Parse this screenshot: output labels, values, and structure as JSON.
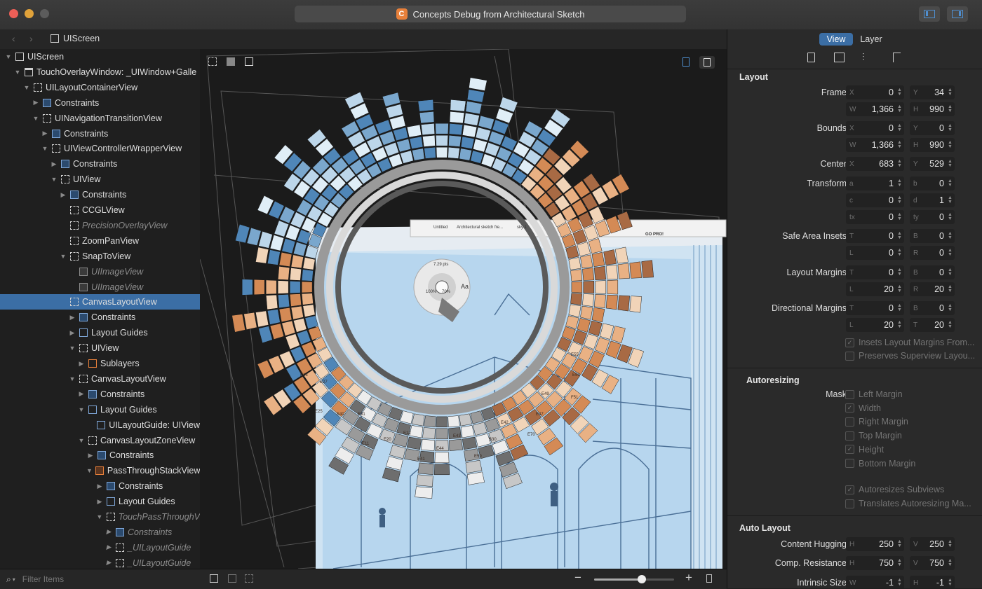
{
  "window": {
    "title": "Concepts Debug from Architectural Sketch",
    "app_icon_glyph": "C",
    "accent_color": "#3b6ea5"
  },
  "navigator": {
    "breadcrumb": "UIScreen",
    "filter_placeholder": "Filter Items"
  },
  "tree": [
    {
      "label": "UIScreen",
      "depth": 0,
      "icon": "solid",
      "open": true
    },
    {
      "label": "TouchOverlayWindow: _UIWindow+Galle",
      "depth": 1,
      "icon": "window",
      "open": true
    },
    {
      "label": "UILayoutContainerView",
      "depth": 2,
      "icon": "dash",
      "open": true
    },
    {
      "label": "Constraints",
      "depth": 3,
      "icon": "cons",
      "open": false
    },
    {
      "label": "UINavigationTransitionView",
      "depth": 3,
      "icon": "dash",
      "open": true
    },
    {
      "label": "Constraints",
      "depth": 4,
      "icon": "cons",
      "open": false
    },
    {
      "label": "UIViewControllerWrapperView",
      "depth": 4,
      "icon": "dash",
      "open": true
    },
    {
      "label": "Constraints",
      "depth": 5,
      "icon": "cons",
      "open": false
    },
    {
      "label": "UIView",
      "depth": 5,
      "icon": "dash",
      "open": true
    },
    {
      "label": "Constraints",
      "depth": 6,
      "icon": "cons",
      "open": false
    },
    {
      "label": "CCGLView",
      "depth": 6,
      "icon": "dash",
      "open": null
    },
    {
      "label": "PrecisionOverlayView",
      "depth": 6,
      "icon": "dash",
      "open": null,
      "dim": true
    },
    {
      "label": "ZoomPanView",
      "depth": 6,
      "icon": "dash",
      "open": null
    },
    {
      "label": "SnapToView",
      "depth": 6,
      "icon": "dash",
      "open": true
    },
    {
      "label": "UIImageView",
      "depth": 7,
      "icon": "img",
      "open": null,
      "dim": true
    },
    {
      "label": "UIImageView",
      "depth": 7,
      "icon": "img",
      "open": null,
      "dim": true
    },
    {
      "label": "CanvasLayoutView",
      "depth": 6,
      "icon": "dash",
      "open": null,
      "selected": true
    },
    {
      "label": "Constraints",
      "depth": 7,
      "icon": "cons",
      "open": false
    },
    {
      "label": "Layout Guides",
      "depth": 7,
      "icon": "guide",
      "open": false
    },
    {
      "label": "UIView",
      "depth": 7,
      "icon": "dash",
      "open": true
    },
    {
      "label": "Sublayers",
      "depth": 8,
      "icon": "sub",
      "open": false
    },
    {
      "label": "CanvasLayoutView",
      "depth": 7,
      "icon": "dash",
      "open": true
    },
    {
      "label": "Constraints",
      "depth": 8,
      "icon": "cons",
      "open": false
    },
    {
      "label": "Layout Guides",
      "depth": 8,
      "icon": "guide",
      "open": true
    },
    {
      "label": "UILayoutGuide: UIView",
      "depth": 9,
      "icon": "guide",
      "open": null
    },
    {
      "label": "CanvasLayoutZoneView",
      "depth": 8,
      "icon": "dash",
      "open": true
    },
    {
      "label": "Constraints",
      "depth": 9,
      "icon": "cons",
      "open": false
    },
    {
      "label": "PassThroughStackView",
      "depth": 9,
      "icon": "stack",
      "open": true
    },
    {
      "label": "Constraints",
      "depth": 10,
      "icon": "cons",
      "open": false
    },
    {
      "label": "Layout Guides",
      "depth": 10,
      "icon": "guide",
      "open": false
    },
    {
      "label": "TouchPassThroughV",
      "depth": 10,
      "icon": "dash",
      "open": true,
      "dim": true
    },
    {
      "label": "Constraints",
      "depth": 11,
      "icon": "cons",
      "open": false,
      "dim": true
    },
    {
      "label": "_UILayoutGuide",
      "depth": 11,
      "icon": "dash",
      "open": false,
      "dim": true
    },
    {
      "label": "_UILayoutGuide",
      "depth": 11,
      "icon": "dash",
      "open": false,
      "dim": true
    }
  ],
  "canvas": {
    "doc_tab_untitled": "Untitled",
    "doc_tab_name": "Architectural sketch fre...",
    "doc_tab_layer": "sky 1",
    "doc_tab_action": "GO PRO!",
    "wheel_size": "7.29 pts",
    "wheel_opacity": "100%",
    "wheel_smoothing": "70%",
    "wheel_text": "Aa",
    "zoom_level": 0.6,
    "wheel_labels": [
      "E55",
      "E53",
      "F51",
      "E49",
      "E47",
      "E70",
      "E42",
      "B30",
      "E50",
      "E43",
      "E44",
      "E41",
      "E12",
      "E20",
      "E11",
      "E31",
      "E40",
      "E25",
      "E27",
      "E13"
    ],
    "palette_colors": [
      "#e0eef7",
      "#bcd6ea",
      "#7aa7cd",
      "#4f86b8",
      "#f1d4b8",
      "#e9b184",
      "#d48a55",
      "#a86a44",
      "#6e6e6e",
      "#9a9a9a",
      "#c7c7c7",
      "#ededed"
    ]
  },
  "inspector": {
    "tab_view": "View",
    "tab_layer": "Layer",
    "layout_title": "Layout",
    "frame_label": "Frame",
    "frame": {
      "x": "0",
      "y": "34",
      "w": "1,366",
      "h": "990"
    },
    "bounds_label": "Bounds",
    "bounds": {
      "x": "0",
      "y": "0",
      "w": "1,366",
      "h": "990"
    },
    "center_label": "Center",
    "center": {
      "x": "683",
      "y": "529"
    },
    "transform_label": "Transform",
    "transform": {
      "a": "1",
      "b": "0",
      "c": "0",
      "d": "1",
      "tx": "0",
      "ty": "0"
    },
    "safe_area_label": "Safe Area Insets",
    "safe_area": {
      "t": "0",
      "b": "0",
      "l": "0",
      "r": "0"
    },
    "layout_margins_label": "Layout Margins",
    "layout_margins": {
      "t": "0",
      "b": "0",
      "l": "20",
      "r": "20"
    },
    "directional_label": "Directional Margins",
    "directional": {
      "t": "0",
      "b": "0",
      "l": "20",
      "t2": "20"
    },
    "insets_from_safe": "Insets Layout Margins From...",
    "preserves_superview": "Preserves Superview Layou...",
    "autoresizing_title": "Autoresizing",
    "mask_label": "Mask",
    "mask_items": [
      "Left Margin",
      "Width",
      "Right Margin",
      "Top Margin",
      "Height",
      "Bottom Margin"
    ],
    "autoresizes_subviews": "Autoresizes Subviews",
    "translates_mask": "Translates Autoresizing Ma...",
    "auto_layout_title": "Auto Layout",
    "content_hugging_label": "Content Hugging",
    "content_hugging": {
      "h": "250",
      "v": "250"
    },
    "compression_label": "Comp. Resistance",
    "compression": {
      "h": "750",
      "v": "750"
    },
    "intrinsic_label": "Intrinsic Size",
    "intrinsic": {
      "w": "-1",
      "h": "-1"
    }
  }
}
